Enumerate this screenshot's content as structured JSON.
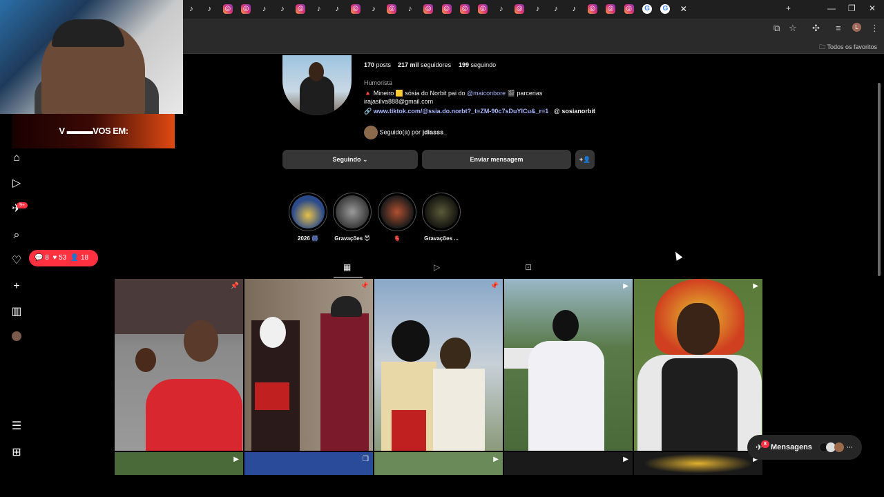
{
  "browser": {
    "tab_count": 33,
    "bookmarks_folder": "Todos os favoritos"
  },
  "stream": {
    "banner_text": "V ▬▬▬VOS EM:"
  },
  "sidebar": {
    "notif_badge": "9+",
    "activity": {
      "comments": "8",
      "likes": "53",
      "followers": "18"
    }
  },
  "profile": {
    "posts_count": "170",
    "posts_label": "posts",
    "followers_count": "217 mil",
    "followers_label": "seguidores",
    "following_count": "199",
    "following_label": "seguindo",
    "category": "Humorista",
    "bio_line1_prefix": "🔺 Mineiro 🟨 sósia do Norbit pai do ",
    "bio_mention": "@maiconbore",
    "bio_line1_suffix": " 🎬 parcerias",
    "bio_email": "irajasilva888@gmail.com",
    "link": "www.tiktok.com/@ssia.do.norbt?_t=ZM-90c7sDuYICu&_r=1",
    "threads_handle": "sosianorbit",
    "followed_by_prefix": "Seguido(a) por ",
    "followed_by_user": "jdiasss_"
  },
  "actions": {
    "following_label": "Seguindo",
    "message_label": "Enviar mensagem"
  },
  "highlights": [
    {
      "label": "2026 🎆",
      "color": "#3a5a8a"
    },
    {
      "label": "Gravações 😈",
      "color": "#5a5a5a"
    },
    {
      "label": "🫀",
      "color": "#6a3a2a"
    },
    {
      "label": "Gravações ...",
      "color": "#3a3a2a"
    }
  ],
  "messages": {
    "label": "Mensagens",
    "badge": "8"
  }
}
